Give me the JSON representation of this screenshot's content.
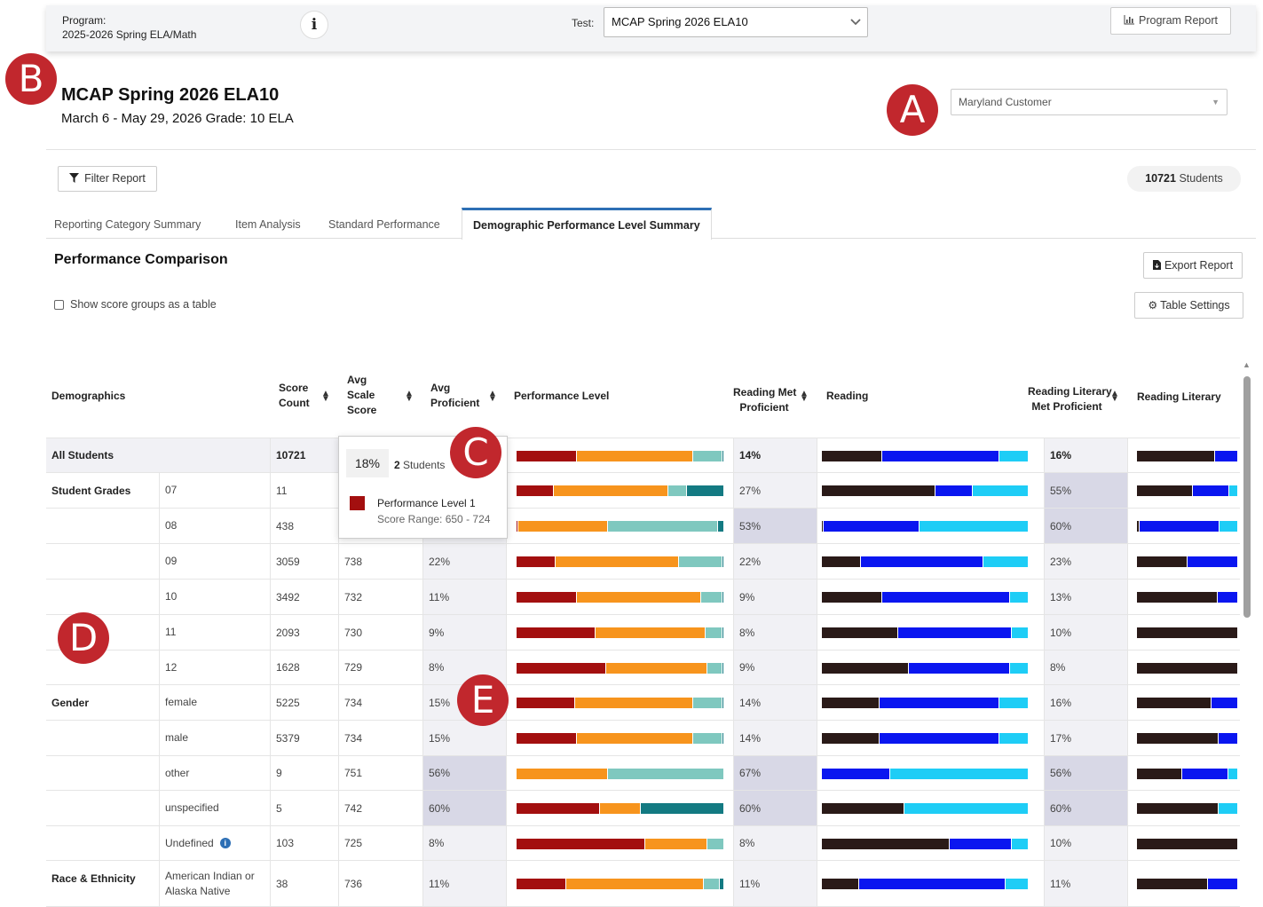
{
  "topbar": {
    "program_label": "Program:",
    "program_value": "2025-2026 Spring ELA/Math",
    "info_glyph": "i",
    "test_label": "Test:",
    "test_value": "MCAP Spring 2026 ELA10",
    "program_report_label": "Program Report"
  },
  "markers": {
    "a": "A",
    "b": "B",
    "c": "C",
    "d": "D",
    "e": "E"
  },
  "header": {
    "title": "MCAP Spring 2026 ELA10",
    "subtitle": "March 6 - May 29, 2026  Grade: 10 ELA",
    "customer_select": "Maryland Customer"
  },
  "toolbar": {
    "filter_label": "Filter Report",
    "students_count": "10721",
    "students_label": "Students"
  },
  "tabs": [
    {
      "label": "Reporting Category Summary"
    },
    {
      "label": "Item Analysis"
    },
    {
      "label": "Standard Performance"
    },
    {
      "label": "Demographic Performance Level Summary"
    }
  ],
  "section": {
    "title": "Performance Comparison",
    "export_label": "Export Report",
    "settings_label": "Table Settings",
    "checkbox_label": "Show score groups as a table"
  },
  "table": {
    "headers": {
      "demographics": "Demographics",
      "score_count_1": "Score",
      "score_count_2": "Count",
      "avg_scale_1": "Avg",
      "avg_scale_2": "Scale",
      "avg_scale_3": "Score",
      "avg_prof_1": "Avg",
      "avg_prof_2": "Proficient",
      "perf_level": "Performance Level",
      "reading_met_1": "Reading Met",
      "reading_met_2": "Proficient",
      "reading": "Reading",
      "lit_met_1": "Reading Literary",
      "lit_met_2": "Met Proficient",
      "lit": "Reading Literary"
    },
    "colors": {
      "perf": [
        "#a30f0f",
        "#f7941d",
        "#7fc8bf",
        "#137a82"
      ],
      "reading": [
        "#2a1a18",
        "#0a16f0",
        "#1ecdf6"
      ]
    },
    "rows": [
      {
        "group": "All Students",
        "sub": "",
        "count": "10721",
        "scale": "",
        "prof": "",
        "pl": [
          29,
          56,
          14,
          1
        ],
        "rmet": "14%",
        "rd": [
          29,
          57,
          14
        ],
        "lmet": "16%",
        "ld": [
          77,
          23,
          0
        ],
        "bold": true
      },
      {
        "group": "Student Grades",
        "sub": "07",
        "count": "11",
        "scale": "",
        "prof": "",
        "pl": [
          18,
          55,
          9,
          18
        ],
        "rmet": "27%",
        "rd": [
          55,
          18,
          27
        ],
        "lmet": "55%",
        "ld": [
          55,
          36,
          9
        ]
      },
      {
        "group": "",
        "sub": "08",
        "count": "438",
        "scale": "",
        "prof": "",
        "pl": [
          1,
          43,
          53,
          3
        ],
        "rmet": "53%",
        "rd": [
          1,
          46,
          53
        ],
        "lmet": "60%",
        "ld": [
          3,
          79,
          18
        ]
      },
      {
        "group": "",
        "sub": "09",
        "count": "3059",
        "scale": "738",
        "prof": "22%",
        "pl": [
          19,
          59,
          21,
          1
        ],
        "rmet": "22%",
        "rd": [
          19,
          59,
          22
        ],
        "lmet": "23%",
        "ld": [
          50,
          50,
          0
        ]
      },
      {
        "group": "",
        "sub": "10",
        "count": "3492",
        "scale": "732",
        "prof": "11%",
        "pl": [
          29,
          60,
          10,
          1
        ],
        "rmet": "9%",
        "rd": [
          29,
          62,
          9
        ],
        "lmet": "13%",
        "ld": [
          80,
          20,
          0
        ]
      },
      {
        "group": "",
        "sub": "11",
        "count": "2093",
        "scale": "730",
        "prof": "9%",
        "pl": [
          38,
          53,
          8,
          1
        ],
        "rmet": "8%",
        "rd": [
          37,
          55,
          8
        ],
        "lmet": "10%",
        "ld": [
          100,
          0,
          0
        ]
      },
      {
        "group": "",
        "sub": "12",
        "count": "1628",
        "scale": "729",
        "prof": "8%",
        "pl": [
          43,
          49,
          7,
          1
        ],
        "rmet": "9%",
        "rd": [
          42,
          49,
          9
        ],
        "lmet": "8%",
        "ld": [
          100,
          0,
          0
        ]
      },
      {
        "group": "Gender",
        "sub": "female",
        "count": "5225",
        "scale": "734",
        "prof": "15%",
        "pl": [
          28,
          57,
          14,
          1
        ],
        "rmet": "14%",
        "rd": [
          28,
          58,
          14
        ],
        "lmet": "16%",
        "ld": [
          74,
          26,
          0
        ]
      },
      {
        "group": "",
        "sub": "male",
        "count": "5379",
        "scale": "734",
        "prof": "15%",
        "pl": [
          29,
          56,
          14,
          1
        ],
        "rmet": "14%",
        "rd": [
          28,
          58,
          14
        ],
        "lmet": "17%",
        "ld": [
          81,
          19,
          0
        ]
      },
      {
        "group": "",
        "sub": "other",
        "count": "9",
        "scale": "751",
        "prof": "56%",
        "pl": [
          0,
          44,
          56,
          0
        ],
        "rmet": "67%",
        "rd": [
          0,
          33,
          67
        ],
        "lmet": "56%",
        "ld": [
          45,
          45,
          10
        ]
      },
      {
        "group": "",
        "sub": "unspecified",
        "count": "5",
        "scale": "742",
        "prof": "60%",
        "pl": [
          40,
          20,
          0,
          40
        ],
        "rmet": "60%",
        "rd": [
          40,
          0,
          60
        ],
        "lmet": "60%",
        "ld": [
          81,
          0,
          19
        ]
      },
      {
        "group": "",
        "sub": "Undefined",
        "count": "103",
        "scale": "725",
        "prof": "8%",
        "pl": [
          62,
          30,
          8,
          0
        ],
        "rmet": "8%",
        "rd": [
          62,
          30,
          8
        ],
        "lmet": "10%",
        "ld": [
          100,
          0,
          0
        ],
        "info": true
      },
      {
        "group": "Race & Ethnicity",
        "sub": "American Indian or Alaska Native",
        "count": "38",
        "scale": "736",
        "prof": "11%",
        "pl": [
          24,
          66,
          8,
          2
        ],
        "rmet": "11%",
        "rd": [
          18,
          71,
          11
        ],
        "lmet": "11%",
        "ld": [
          70,
          30,
          0
        ]
      }
    ]
  },
  "tooltip": {
    "pct": "18%",
    "count": "2",
    "students_label": "Students",
    "level": "Performance Level 1",
    "range": "Score Range: 650 - 724"
  }
}
